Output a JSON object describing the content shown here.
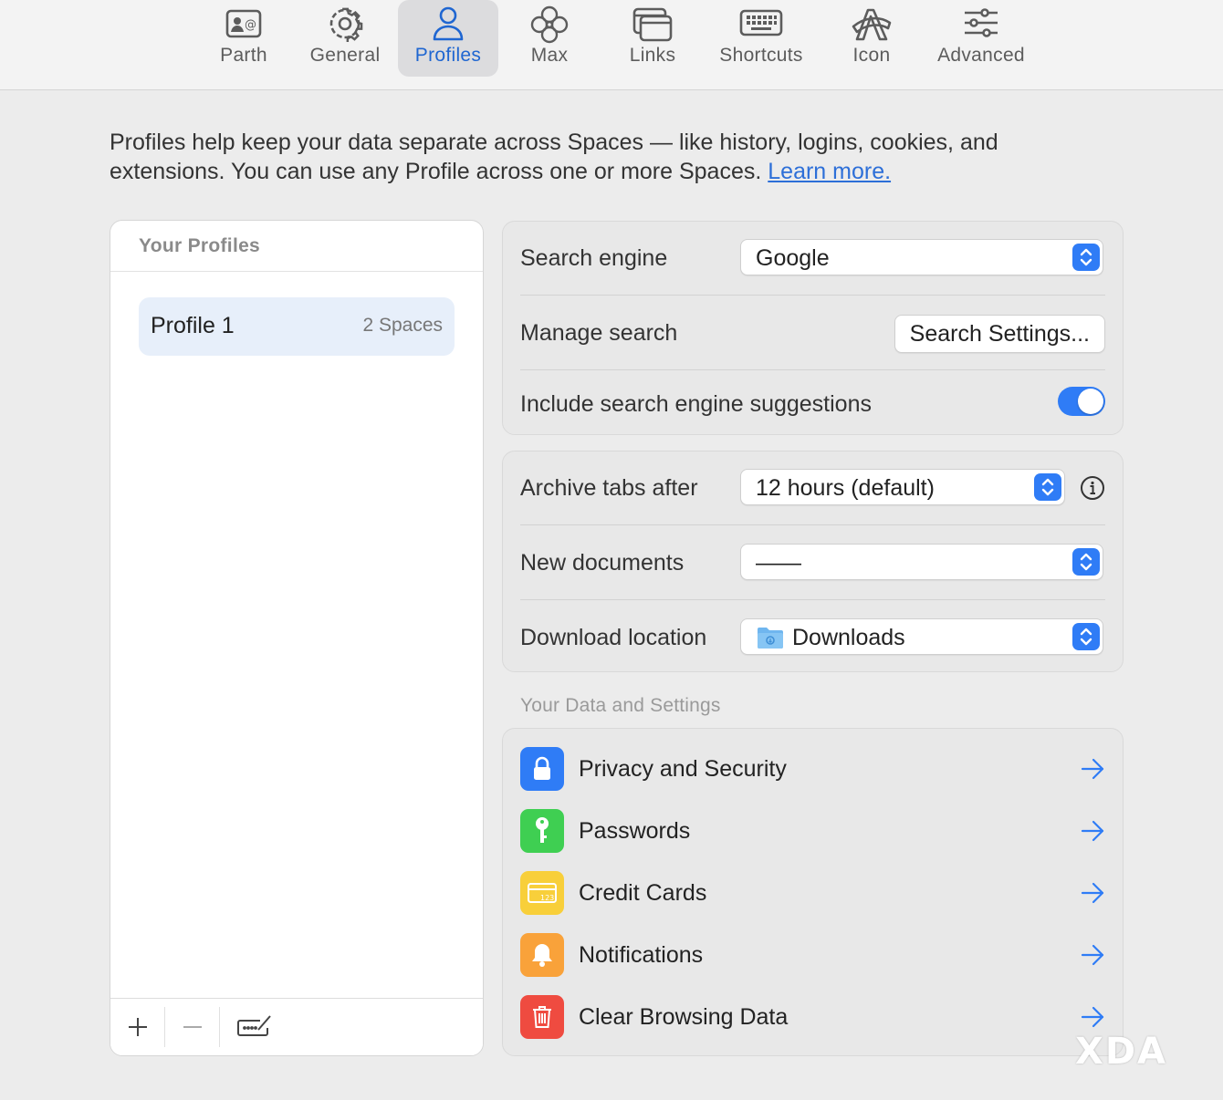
{
  "toolbar": {
    "tabs": [
      {
        "label": "Parth",
        "icon": "contact-card-icon"
      },
      {
        "label": "General",
        "icon": "gear-icon"
      },
      {
        "label": "Profiles",
        "icon": "person-icon",
        "active": true
      },
      {
        "label": "Max",
        "icon": "flower-icon"
      },
      {
        "label": "Links",
        "icon": "windows-icon"
      },
      {
        "label": "Shortcuts",
        "icon": "keyboard-icon"
      },
      {
        "label": "Icon",
        "icon": "arc-logo-icon"
      },
      {
        "label": "Advanced",
        "icon": "sliders-icon"
      }
    ]
  },
  "intro": {
    "text": "Profiles help keep your data separate across Spaces — like history, logins, cookies, and extensions. You can use any Profile across one or more Spaces.",
    "link": "Learn more."
  },
  "profiles": {
    "header": "Your Profiles",
    "items": [
      {
        "name": "Profile 1",
        "spaces": "2 Spaces"
      }
    ]
  },
  "search": {
    "engine_label": "Search engine",
    "engine_value": "Google",
    "manage_label": "Manage search",
    "manage_button": "Search Settings...",
    "suggestions_label": "Include search engine suggestions",
    "suggestions_on": true
  },
  "tabs_settings": {
    "archive_label": "Archive tabs after",
    "archive_value": "12 hours (default)",
    "new_docs_label": "New documents",
    "new_docs_value": "——",
    "download_label": "Download location",
    "download_value": "Downloads"
  },
  "data_settings": {
    "title": "Your Data and Settings",
    "items": [
      {
        "label": "Privacy and Security",
        "icon": "lock-icon",
        "color": "#2f7cf6"
      },
      {
        "label": "Passwords",
        "icon": "key-icon",
        "color": "#3fcf52"
      },
      {
        "label": "Credit Cards",
        "icon": "credit-card-icon",
        "color": "#f8cf3a"
      },
      {
        "label": "Notifications",
        "icon": "bell-icon",
        "color": "#f9a23a"
      },
      {
        "label": "Clear Browsing Data",
        "icon": "trash-icon",
        "color": "#ef4b40"
      }
    ]
  },
  "watermark": "XDA",
  "colors": {
    "accent": "#2f7cf6",
    "link": "#2d6fd8"
  }
}
